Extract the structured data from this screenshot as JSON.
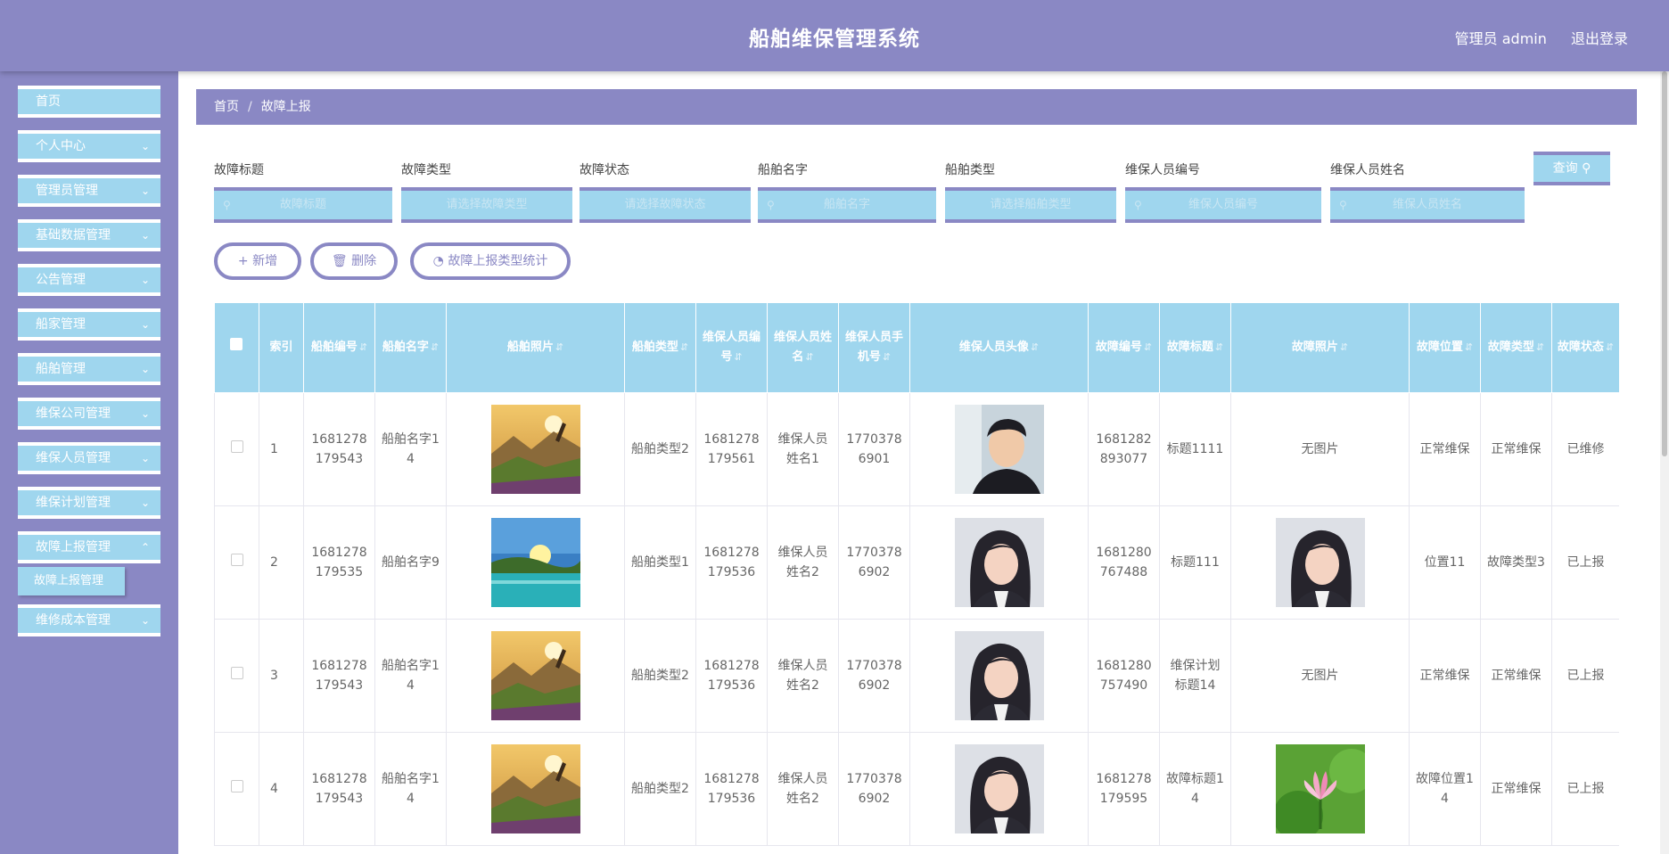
{
  "header": {
    "title": "船舶维保管理系统",
    "user": "管理员 admin",
    "logout": "退出登录"
  },
  "sidebar": {
    "items": [
      {
        "label": "首页"
      },
      {
        "label": "个人中心"
      },
      {
        "label": "管理员管理"
      },
      {
        "label": "基础数据管理"
      },
      {
        "label": "公告管理"
      },
      {
        "label": "船家管理"
      },
      {
        "label": "船舶管理"
      },
      {
        "label": "维保公司管理"
      },
      {
        "label": "维保人员管理"
      },
      {
        "label": "维保计划管理"
      },
      {
        "label": "故障上报管理"
      },
      {
        "label": "维修成本管理"
      }
    ],
    "active_sub": "故障上报管理"
  },
  "breadcrumb": {
    "home": "首页",
    "sep": "/",
    "current": "故障上报"
  },
  "filters": [
    {
      "label": "故障标题",
      "placeholder": "故障标题"
    },
    {
      "label": "故障类型",
      "placeholder": "请选择故障类型"
    },
    {
      "label": "故障状态",
      "placeholder": "请选择故障状态"
    },
    {
      "label": "船舶名字",
      "placeholder": "船舶名字"
    },
    {
      "label": "船舶类型",
      "placeholder": "请选择船舶类型"
    },
    {
      "label": "维保人员编号",
      "placeholder": "维保人员编号"
    },
    {
      "label": "维保人员姓名",
      "placeholder": "维保人员姓名"
    }
  ],
  "query_button": "查询",
  "actions": {
    "add": "新增",
    "delete": "删除",
    "stats": "故障上报类型统计"
  },
  "table": {
    "columns": [
      "索引",
      "船舶编号",
      "船舶名字",
      "船舶照片",
      "船舶类型",
      "维保人员编号",
      "维保人员姓名",
      "维保人员手机号",
      "维保人员头像",
      "故障编号",
      "故障标题",
      "故障照片",
      "故障位置",
      "故障类型",
      "故障状态"
    ],
    "rows": [
      {
        "index": "1",
        "ship_no": "1681278179543",
        "ship_name": "船舶名字14",
        "ship_photo": "mountain",
        "ship_type": "船舶类型2",
        "staff_no": "1681278179561",
        "staff_name": "维保人员姓名1",
        "staff_phone": "17703786901",
        "avatar": "man",
        "fault_no": "1681282893077",
        "fault_title": "标题1111",
        "fault_photo": "无图片",
        "fault_pos": "正常维保",
        "fault_type": "正常维保",
        "fault_status": "已维修"
      },
      {
        "index": "2",
        "ship_no": "1681278179535",
        "ship_name": "船舶名字9",
        "ship_photo": "lake",
        "ship_type": "船舶类型1",
        "staff_no": "1681278179536",
        "staff_name": "维保人员姓名2",
        "staff_phone": "17703786902",
        "avatar": "girl",
        "fault_no": "1681280767488",
        "fault_title": "标题111",
        "fault_photo": "girl",
        "fault_pos": "位置11",
        "fault_type": "故障类型3",
        "fault_status": "已上报"
      },
      {
        "index": "3",
        "ship_no": "1681278179543",
        "ship_name": "船舶名字14",
        "ship_photo": "mountain",
        "ship_type": "船舶类型2",
        "staff_no": "1681278179536",
        "staff_name": "维保人员姓名2",
        "staff_phone": "17703786902",
        "avatar": "girl",
        "fault_no": "1681280757490",
        "fault_title": "维保计划标题14",
        "fault_photo": "无图片",
        "fault_pos": "正常维保",
        "fault_type": "正常维保",
        "fault_status": "已上报"
      },
      {
        "index": "4",
        "ship_no": "1681278179543",
        "ship_name": "船舶名字14",
        "ship_photo": "mountain",
        "ship_type": "船舶类型2",
        "staff_no": "1681278179536",
        "staff_name": "维保人员姓名2",
        "staff_phone": "17703786902",
        "avatar": "girl",
        "fault_no": "1681278179595",
        "fault_title": "故障标题14",
        "fault_photo": "lotus",
        "fault_pos": "故障位置14",
        "fault_type": "正常维保",
        "fault_status": "已上报"
      }
    ]
  },
  "colors": {
    "primary": "#8a88c4",
    "accent": "#9fd6ee"
  }
}
